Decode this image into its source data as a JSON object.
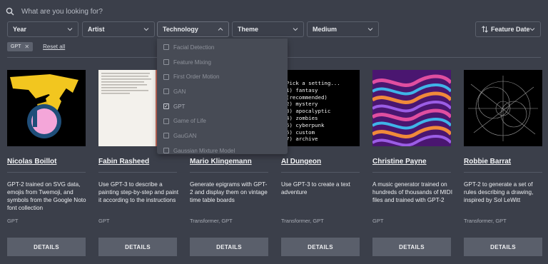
{
  "search": {
    "placeholder": "What are you looking for?"
  },
  "filters": {
    "year": "Year",
    "artist": "Artist",
    "technology": "Technology",
    "theme": "Theme",
    "medium": "Medium",
    "sort": "Feature Date"
  },
  "active_filters": {
    "chip": "GPT",
    "reset": "Reset all"
  },
  "technology_menu": [
    {
      "label": "Facial Detection",
      "checked": false
    },
    {
      "label": "Feature Mixing",
      "checked": false
    },
    {
      "label": "First Order Motion",
      "checked": false
    },
    {
      "label": "GAN",
      "checked": false
    },
    {
      "label": "GPT",
      "checked": true
    },
    {
      "label": "Game of Life",
      "checked": false
    },
    {
      "label": "GauGAN",
      "checked": false
    },
    {
      "label": "Gaussian Mixture Model",
      "checked": false
    }
  ],
  "cards": [
    {
      "artist": "Nicolas Boillot",
      "description": "GPT-2 trained on SVG data, emojis from Twemoji, and symbols from the Google Noto font collection",
      "tags": "GPT",
      "button": "DETAILS"
    },
    {
      "artist": "Fabin Rasheed",
      "description": "Use GPT-3 to describe a painting step-by-step and paint it according to the instructions",
      "tags": "GPT",
      "button": "DETAILS"
    },
    {
      "artist": "Mario Klingemann",
      "description": "Generate epigrams with GPT-2 and display them on vintage time table boards",
      "tags": "Transformer, GPT",
      "button": "DETAILS"
    },
    {
      "artist": "AI Dungeon",
      "description": "Use GPT-3 to create a text adventure",
      "tags": "Transformer, GPT",
      "button": "DETAILS"
    },
    {
      "artist": "Christine Payne",
      "description": "A music generator trained on hundreds of thousands of MIDI files and trained with GPT-2",
      "tags": "GPT",
      "button": "DETAILS"
    },
    {
      "artist": "Robbie Barrat",
      "description": "GPT-2 to generate a set of rules describing a drawing, inspired by Sol LeWitt",
      "tags": "Transformer, GPT",
      "button": "DETAILS"
    }
  ],
  "dungeon_thumb": {
    "prompt": "Pick a setting...",
    "options": [
      "1) fantasy (recommended)",
      "2) mystery",
      "3) apocalyptic",
      "4) zombies",
      "5) cyberpunk",
      "6) custom",
      "7) archive"
    ]
  },
  "colors": {
    "background": "#3b3f4a",
    "button": "#5a5f6b",
    "accent_yellow": "#f2c61f",
    "accent_pink": "#f4a6d9",
    "accent_blue": "#1f4e79"
  }
}
